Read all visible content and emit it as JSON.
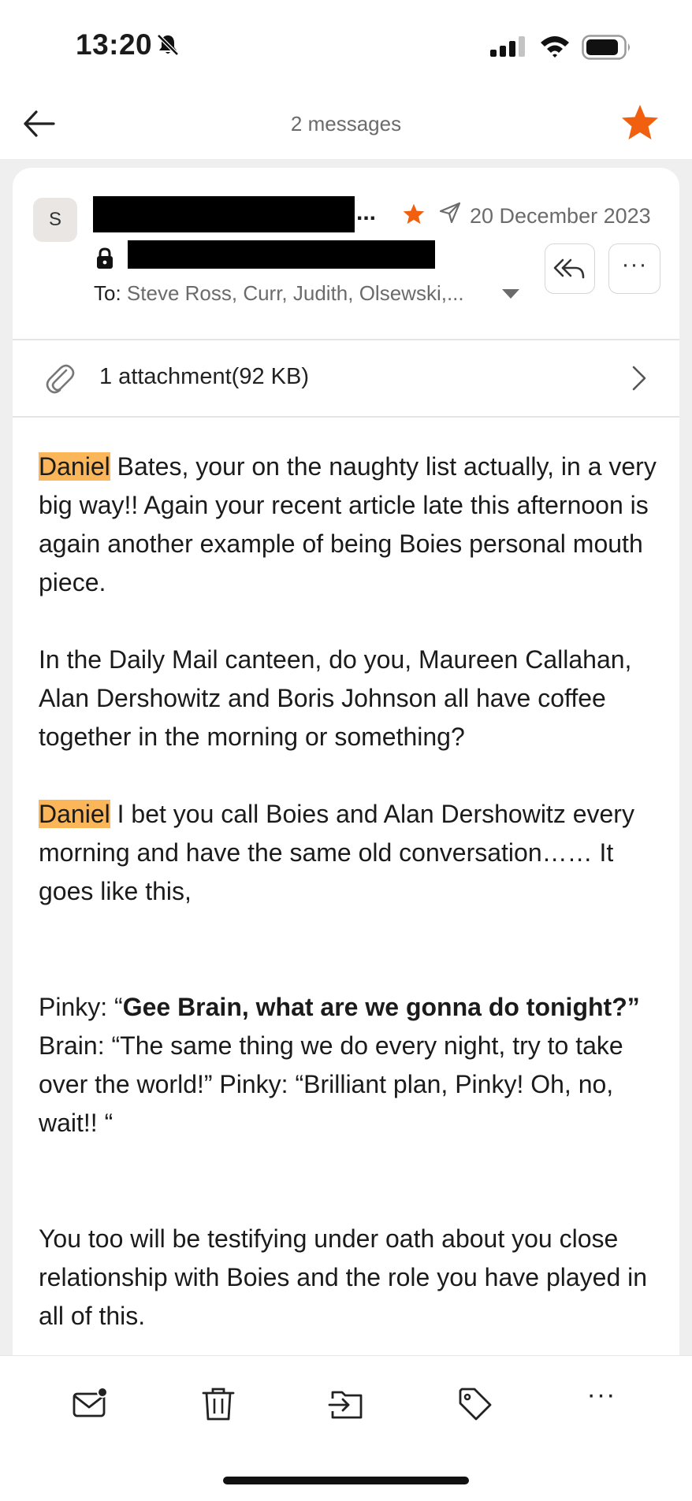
{
  "status_bar": {
    "time": "13:20"
  },
  "nav": {
    "title": "2 messages"
  },
  "message": {
    "avatar_letter": "S",
    "sender_ellipsis": "...",
    "date": "20 December 2023",
    "to_label": "To:",
    "to_recipients": "Steve Ross, Curr, Judith, Olsewski,...",
    "more_label": "···"
  },
  "attachment": {
    "label": "1 attachment(92 KB)"
  },
  "body": {
    "p1_name": "Daniel",
    "p1_text": " Bates, your on the naughty list actually, in a very big way!! Again your recent article late this afternoon is again another example of being Boies personal mouth piece.",
    "p2_text": "In the Daily Mail canteen, do you, Maureen Callahan, Alan Dershowitz and Boris Johnson all have coffee together in the morning or something?",
    "p3_name": "Daniel",
    "p3_text": " I bet you call Boies and Alan Dershowitz every morning and have the same old conversation…… It goes like this,",
    "p4_prefix": "Pinky: “",
    "p4_bold": "Gee Brain, what are we gonna do tonight?”",
    "p4_rest": " Brain: “The same thing we do every night, try to take over the world!” Pinky: “Brilliant plan, Pinky! Oh, no, wait!! “",
    "p5_text": "You too will be testifying under oath about you close relationship with Boies and the role you have played in all of this."
  },
  "toolbar": {
    "icons": [
      "mark-unread-icon",
      "trash-icon",
      "move-to-folder-icon",
      "tag-icon",
      "more-icon"
    ],
    "more_label": "···"
  },
  "colors": {
    "accent": "#f0600e",
    "highlight": "#fbb65a",
    "muted_text": "#6b6b6b"
  }
}
